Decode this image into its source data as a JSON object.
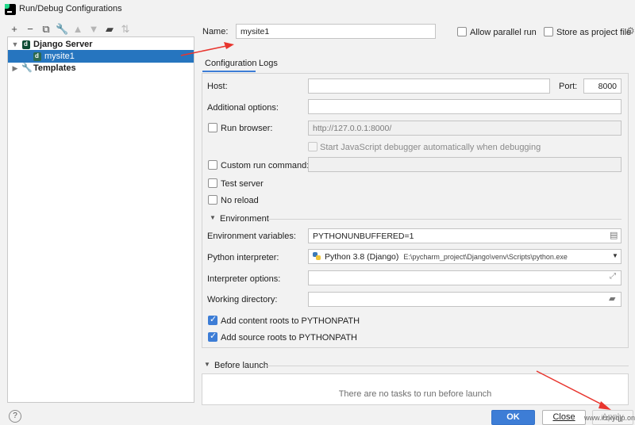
{
  "window": {
    "title": "Run/Debug Configurations"
  },
  "toolbar": {
    "icons": [
      "plus-icon",
      "minus-icon",
      "copy-icon",
      "wrench-icon",
      "arrow-up-icon",
      "arrow-down-icon",
      "folder-icon",
      "sort-icon"
    ]
  },
  "tree": {
    "items": [
      {
        "label": "Django Server",
        "expanded": true
      },
      {
        "label": "mysite1",
        "selected": true
      },
      {
        "label": "Templates",
        "expanded": false
      }
    ]
  },
  "header": {
    "name_label": "Name:",
    "name_value": "mysite1",
    "allow_parallel": "Allow parallel run",
    "store_as_project": "Store as project file"
  },
  "tabs": [
    {
      "label": "Configuration",
      "active": true
    },
    {
      "label": "Logs",
      "active": false
    }
  ],
  "config": {
    "host_label": "Host:",
    "host_value": "",
    "port_label": "Port:",
    "port_value": "8000",
    "additional_label": "Additional options:",
    "run_browser_label": "Run browser:",
    "run_browser_url": "http://127.0.0.1:8000/",
    "js_debugger_label": "Start JavaScript debugger automatically when debugging",
    "custom_cmd_label": "Custom run command:",
    "test_server_label": "Test server",
    "no_reload_label": "No reload",
    "environment_label": "Environment",
    "env_vars_label": "Environment variables:",
    "env_vars_value": "PYTHONUNBUFFERED=1",
    "interpreter_label": "Python interpreter:",
    "interpreter_name": "Python 3.8 (Django)",
    "interpreter_path": "E:\\pycharm_project\\Django\\venv\\Scripts\\python.exe",
    "interp_options_label": "Interpreter options:",
    "working_dir_label": "Working directory:",
    "content_roots_label": "Add content roots to PYTHONPATH",
    "source_roots_label": "Add source roots to PYTHONPATH"
  },
  "before_launch": {
    "label": "Before launch",
    "empty_text": "There are no tasks to run before launch"
  },
  "footer": {
    "help": "?",
    "ok": "OK",
    "close": "Close",
    "apply": "Apply",
    "watermark": "www.itzxyqjp.online"
  },
  "colors": {
    "accent": "#3d7dd6",
    "selection": "#2675bf",
    "annotation": "#e8352e"
  }
}
